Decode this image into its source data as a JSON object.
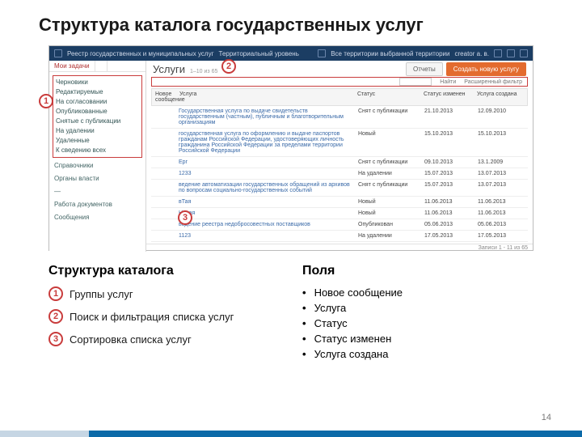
{
  "slide": {
    "title": "Структура каталога государственных услуг",
    "page_number": "14"
  },
  "screenshot": {
    "topbar": {
      "left_label": "Реестр государственных и муниципальных услуг",
      "center_label": "Территориальный уровень",
      "home_label": "Все территории выбранной территории",
      "creator": "creator a. в."
    },
    "sidebar": {
      "tab_active": "Мои задачи",
      "group_items": [
        "Черновики",
        "Редактируемые",
        "На согласовании",
        "Опубликованные",
        "Снятые с публикации",
        "На удалении",
        "Удаленные",
        "К сведению всех"
      ],
      "sections": [
        "Справочники",
        "Органы власти",
        "—",
        "Работа документов",
        "Сообщения"
      ]
    },
    "page_header": {
      "title": "Услуги",
      "count": "1–10 из 65",
      "btn_reports": "Отчеты",
      "btn_create": "Создать новую услугу"
    },
    "filter": {
      "search_action": "Найти",
      "adv_filter": "Расширенный фильтр"
    },
    "table": {
      "headers": {
        "c1": "Новое сообщение",
        "c2": "Услуга",
        "c3": "Статус",
        "c4": "Статус изменен",
        "c5": "Услуга создана"
      },
      "rows": [
        {
          "c2": "Государственная услуга по выдаче свидетельств государственным (частным), публичным и благотворительным организациям",
          "c3": "Снят с публикации",
          "c4": "21.10.2013",
          "c5": "12.09.2010"
        },
        {
          "c2": "государственная услуга по оформлению и выдаче паспортов гражданам Российской Федерации, удостоверяющих личность гражданина Российской Федерации за пределами территории Российской Федерации",
          "c3": "Новый",
          "c4": "15.10.2013",
          "c5": "15.10.2013"
        },
        {
          "c2": "Ерг",
          "c3": "Снят с публикации",
          "c4": "09.10.2013",
          "c5": "13.1.2009"
        },
        {
          "c2": "1233",
          "c3": "На удалении",
          "c4": "15.07.2013",
          "c5": "13.07.2013"
        },
        {
          "c2": "ведение автоматизации государственных обращений из архивов по вопросам социально-государственных событий",
          "c3": "Снят с публикации",
          "c4": "15.07.2013",
          "c5": "13.07.2013"
        },
        {
          "c2": "вТая",
          "c3": "Новый",
          "c4": "11.06.2013",
          "c5": "11.06.2013"
        },
        {
          "c2": "Новая",
          "c3": "Новый",
          "c4": "11.06.2013",
          "c5": "11.06.2013"
        },
        {
          "c2": "ведение реестра недобросовестных поставщиков",
          "c3": "Опубликован",
          "c4": "05.06.2013",
          "c5": "05.06.2013"
        },
        {
          "c2": "1123",
          "c3": "На удалении",
          "c4": "17.05.2013",
          "c5": "17.05.2013"
        }
      ]
    },
    "footer": "Записи 1 - 11 из 65"
  },
  "markers": {
    "m1": "1",
    "m2": "2",
    "m3": "3"
  },
  "legend": {
    "left_title": "Структура каталога",
    "items": [
      {
        "num": "1",
        "text": "Группы услуг"
      },
      {
        "num": "2",
        "text": "Поиск и фильтрация списка услуг"
      },
      {
        "num": "3",
        "text": "Сортировка списка услуг"
      }
    ],
    "right_title": "Поля",
    "fields": [
      "Новое сообщение",
      "Услуга",
      "Статус",
      "Статус изменен",
      "Услуга создана"
    ]
  }
}
